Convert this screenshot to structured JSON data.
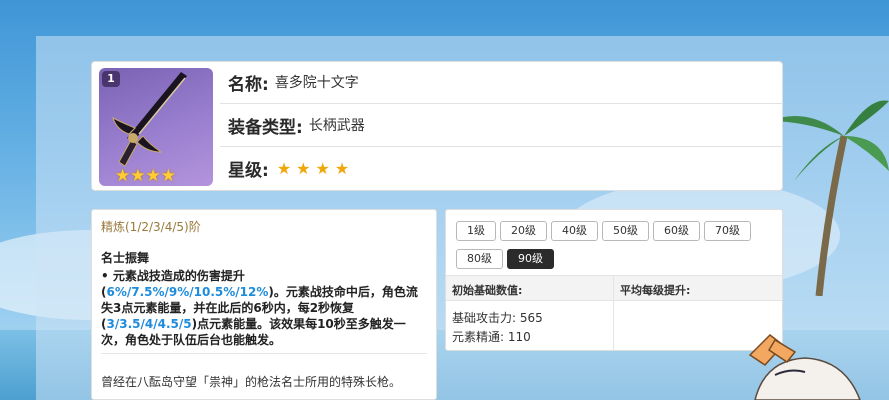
{
  "weapon": {
    "badge": "1",
    "image_stars": "★★★★",
    "name_key": "名称:",
    "name": "喜多院十文字",
    "type_key": "装备类型:",
    "type": "长柄武器",
    "rarity_key": "星级:",
    "rarity_stars": "★★★★"
  },
  "refine": {
    "title": "精炼(1/2/3/4/5)阶",
    "skill_name": "名士振舞",
    "desc_p1": "• 元素战技造成的伤害提升(",
    "desc_v1": "6%/7.5%/9%/10.5%/12%",
    "desc_p2": ")。元素战技命中后，角色流失3点元素能量，并在此后的6秒内，每2秒恢复(",
    "desc_v2": "3/3.5/4/4.5/5",
    "desc_p3": ")点元素能量。该效果每10秒至多触发一次，角色处于队伍后台也能触发。",
    "lore": "曾经在八酝岛守望「祟神」的枪法名士所用的特殊长枪。"
  },
  "levels": {
    "buttons": [
      "1级",
      "20级",
      "40级",
      "50级",
      "60级",
      "70级",
      "80级",
      "90级"
    ],
    "active": "90级"
  },
  "stats": {
    "head_base": "初始基础数值:",
    "head_growth": "平均每级提升:",
    "base_atk": "基础攻击力: 565",
    "em": "元素精通: 110"
  },
  "colors": {
    "highlight": "#1e8cdc",
    "star": "#f0a70a",
    "active_level_bg": "#2b2b2b"
  }
}
